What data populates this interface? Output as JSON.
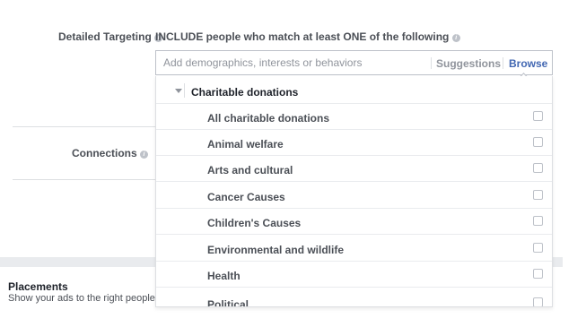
{
  "detailed_targeting": {
    "label": "Detailed Targeting",
    "include_text": "INCLUDE people who match at least ONE of the following"
  },
  "search": {
    "placeholder": "Add demographics, interests or behaviors",
    "suggestions_label": "Suggestions",
    "browse_label": "Browse"
  },
  "connections": {
    "label": "Connections"
  },
  "dropdown": {
    "category": "Charitable donations",
    "items": [
      {
        "label": "All charitable donations",
        "checked": false
      },
      {
        "label": "Animal welfare",
        "checked": false
      },
      {
        "label": "Arts and cultural",
        "checked": false
      },
      {
        "label": "Cancer Causes",
        "checked": false
      },
      {
        "label": "Children's Causes",
        "checked": false
      },
      {
        "label": "Environmental and wildlife",
        "checked": false
      },
      {
        "label": "Health",
        "checked": false
      },
      {
        "label": "Political",
        "checked": false
      }
    ]
  },
  "placements": {
    "title": "Placements",
    "subtitle": "Show your ads to the right people"
  },
  "colors": {
    "link_blue": "#4267b2",
    "suggestions_gray": "#90949c",
    "label_gray": "#4b4f56",
    "separator": "#dddfe2"
  },
  "icons": {
    "info": "info-icon",
    "expand": "triangle-down-icon"
  }
}
